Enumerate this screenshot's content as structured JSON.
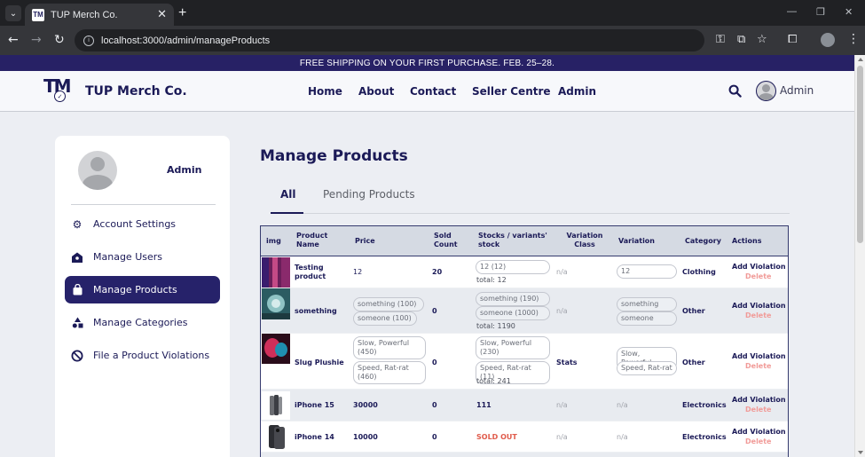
{
  "browser": {
    "tab_title": "TUP Merch Co.",
    "favicon_text": "TM",
    "url": "localhost:3000/admin/manageProducts"
  },
  "announcement": "FREE SHIPPING ON YOUR FIRST PURCHASE. FEB. 25–28.",
  "header": {
    "logo_text": "TM",
    "brand": "TUP Merch Co.",
    "nav": [
      "Home",
      "About",
      "Contact",
      "Seller Centre",
      "Admin"
    ],
    "user_label": "Admin"
  },
  "sidebar": {
    "user_name": "Admin",
    "items": [
      {
        "label": "Account Settings",
        "icon": "gear-icon"
      },
      {
        "label": "Manage Users",
        "icon": "user-group-icon"
      },
      {
        "label": "Manage Products",
        "icon": "bag-icon"
      },
      {
        "label": "Manage Categories",
        "icon": "shapes-icon"
      },
      {
        "label": "File a Product Violations",
        "icon": "ban-icon"
      }
    ],
    "active_index": 2
  },
  "main": {
    "title": "Manage Products",
    "tabs": [
      "All",
      "Pending Products"
    ],
    "active_tab": 0
  },
  "table": {
    "headers": [
      "img",
      "Product Name",
      "Price",
      "Sold Count",
      "Stocks / variants' stock",
      "Variation Class",
      "Variation",
      "Category",
      "Actions"
    ],
    "action_violation": "Add Violation",
    "action_delete": "Delete",
    "rows": [
      {
        "name": "Testing product",
        "price": "12",
        "sold": "20",
        "stocks": [
          "12 (12)"
        ],
        "total": "total: 12",
        "var_class": "n/a",
        "variation": [
          "12"
        ],
        "category": "Clothing"
      },
      {
        "name": "something",
        "price_pills": [
          "something (100)",
          "someone (100)"
        ],
        "sold": "0",
        "stocks": [
          "something (190)",
          "someone (1000)"
        ],
        "total": "total: 1190",
        "var_class": "n/a",
        "variation": [
          "something",
          "someone"
        ],
        "category": "Other"
      },
      {
        "name": "Slug Plushie",
        "price_pills": [
          "Slow, Powerful (450)",
          "Speed, Rat-rat (460)"
        ],
        "sold": "0",
        "stocks": [
          "Slow, Powerful (230)",
          "Speed, Rat-rat (11)"
        ],
        "total": "total: 241",
        "var_class": "Stats",
        "variation": [
          "Slow, Powerful",
          "Speed, Rat-rat"
        ],
        "category": "Other"
      },
      {
        "name": "iPhone 15",
        "price": "30000",
        "sold": "0",
        "stock_plain": "111",
        "var_class": "n/a",
        "variation_plain": "n/a",
        "category": "Electronics"
      },
      {
        "name": "iPhone 14",
        "price": "10000",
        "sold": "0",
        "stock_soldout": "SOLD OUT",
        "var_class": "n/a",
        "variation_plain": "n/a",
        "category": "Electronics"
      }
    ]
  }
}
